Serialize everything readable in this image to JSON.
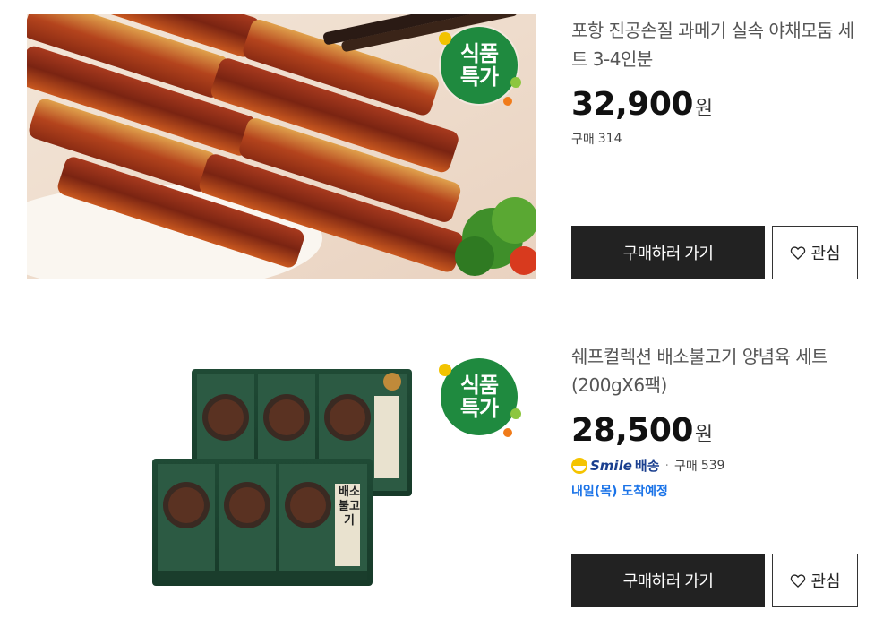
{
  "products": [
    {
      "title": "포항 진공손질 과메기 실속 야채모둠 세트 3-4인분",
      "badge_line1": "식품",
      "badge_line2": "특가",
      "price": "32,900",
      "currency": "원",
      "purchase_label": "구매",
      "purchase_count": "314",
      "buy_label": "구매하러 가기",
      "wish_label": "관심"
    },
    {
      "title": "쉐프컬렉션 배소불고기 양념육 세트 (200gX6팩)",
      "badge_line1": "식품",
      "badge_line2": "특가",
      "price": "28,500",
      "currency": "원",
      "smile_label": "Smile",
      "shipping_label": "배송",
      "separator": "·",
      "purchase_label": "구매",
      "purchase_count": "539",
      "eta": "내일(목) 도착예정",
      "buy_label": "구매하러 가기",
      "wish_label": "관심",
      "package_label": "배소불고기"
    }
  ],
  "colors": {
    "badge": "#1f8a3f",
    "button_dark": "#222222",
    "eta_blue": "#1a73e8",
    "smile_navy": "#1a3f8f"
  }
}
